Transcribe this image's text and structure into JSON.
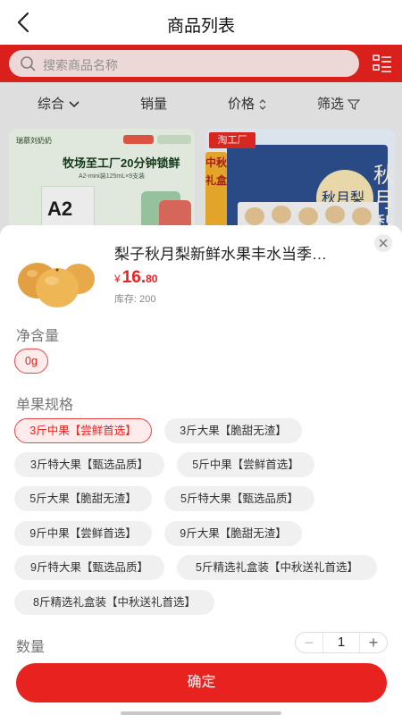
{
  "nav": {
    "title": "商品列表"
  },
  "search": {
    "placeholder": "搜索商品名称"
  },
  "filters": [
    {
      "label": "综合",
      "icon": "chevron-down-icon"
    },
    {
      "label": "销量"
    },
    {
      "label": "价格",
      "icon": "sort-icon"
    },
    {
      "label": "筛选",
      "icon": "filter-icon"
    }
  ],
  "background_cards": [
    {
      "brand": "瑞慕刘奶奶",
      "headline": "牧场至工厂20分钟锁鲜",
      "sub": "A2-mini装125mL×9支装",
      "carton_text": "A2"
    },
    {
      "tag": "淘工厂",
      "gift_text": "中秋礼盒",
      "title_text": "秋月梨",
      "moon_text": "秋月梨"
    }
  ],
  "product": {
    "name": "梨子秋月梨新鲜水果丰水当季…",
    "price_currency": "¥",
    "price_int": "16.",
    "price_dec": "80",
    "stock": "库存: 200"
  },
  "net_content": {
    "label": "净含量",
    "options": [
      "0g"
    ],
    "selected": "0g"
  },
  "spec": {
    "label": "单果规格",
    "options": [
      "3斤中果【尝鲜首选】",
      "3斤大果【脆甜无渣】",
      "3斤特大果【甄选品质】",
      "5斤中果【尝鲜首选】",
      "5斤大果【脆甜无渣】",
      "5斤特大果【甄选品质】",
      "9斤中果【尝鲜首选】",
      "9斤大果【脆甜无渣】",
      "9斤特大果【甄选品质】",
      "5斤精选礼盒装【中秋送礼首选】",
      "8斤精选礼盒装【中秋送礼首选】"
    ],
    "selected": "3斤中果【尝鲜首选】"
  },
  "quantity": {
    "label": "数量",
    "value": "1",
    "minus": "−",
    "plus": "+"
  },
  "confirm_label": "确定",
  "colors": {
    "accent": "#e8221f",
    "chip_bg": "#f0f0f0",
    "chip_selected_bg": "#fdeceb"
  }
}
